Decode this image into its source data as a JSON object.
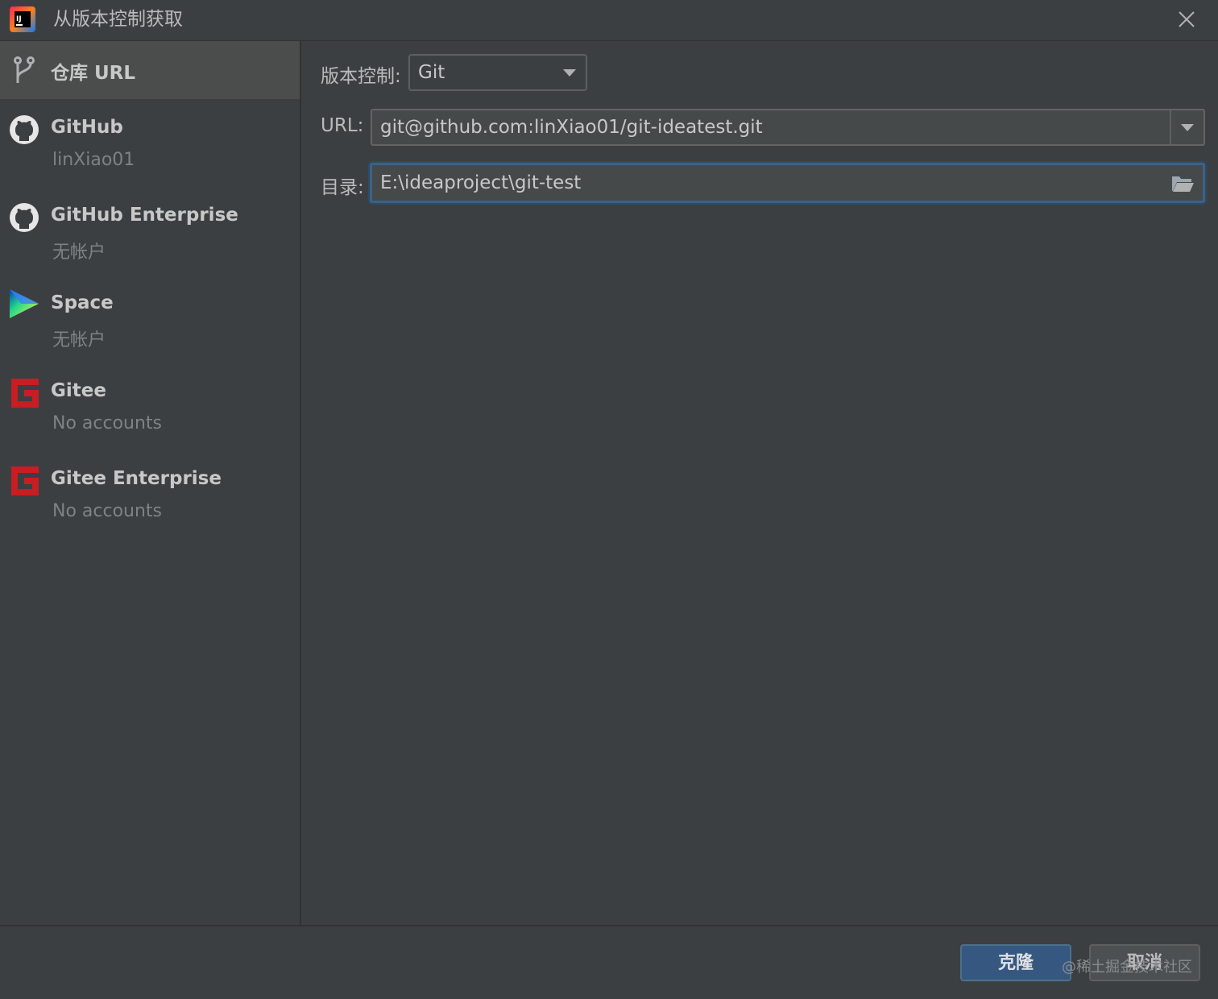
{
  "window": {
    "title": "从版本控制获取",
    "app_icon": "intellij-idea-icon",
    "close_icon": "close-icon"
  },
  "sidebar": {
    "items": [
      {
        "title": "仓库 URL",
        "subtitle": "",
        "icon": "git-branch-icon",
        "selected": true
      },
      {
        "title": "GitHub",
        "subtitle": "linXiao01",
        "icon": "github-icon"
      },
      {
        "title": "GitHub Enterprise",
        "subtitle": "无帐户",
        "icon": "github-icon"
      },
      {
        "title": "Space",
        "subtitle": "无帐户",
        "icon": "space-icon"
      },
      {
        "title": "Gitee",
        "subtitle": "No accounts",
        "icon": "gitee-icon"
      },
      {
        "title": "Gitee Enterprise",
        "subtitle": "No accounts",
        "icon": "gitee-icon"
      }
    ]
  },
  "form": {
    "vcs_label": "版本控制:",
    "vcs_value": "Git",
    "url_label": "URL:",
    "url_value": "git@github.com:linXiao01/git-ideatest.git",
    "dir_label": "目录:",
    "dir_value": "E:\\ideaproject\\git-test"
  },
  "footer": {
    "clone_label": "克隆",
    "cancel_label": "取消",
    "watermark": "@稀土掘金技术社区"
  },
  "colors": {
    "background": "#3c3f41",
    "selected": "#4b4d4d",
    "primary_button": "#365880",
    "focus_border": "#3d6185",
    "gitee_red": "#c71d23"
  }
}
